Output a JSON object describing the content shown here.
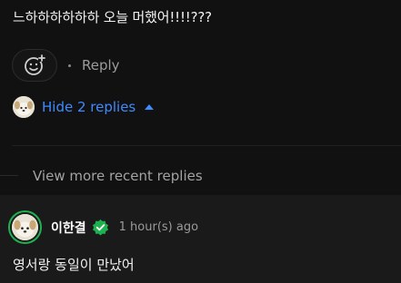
{
  "comment": {
    "text": "느하하하하하하 오늘 머했어!!!!???",
    "reply_label": "Reply",
    "replies_toggle_label": "Hide 2 replies"
  },
  "thread": {
    "view_more_label": "View more recent replies"
  },
  "reply": {
    "username": "이한결",
    "timestamp": "1 hour(s) ago",
    "text": "영서랑 동일이 만났어"
  },
  "colors": {
    "background": "#111111",
    "reply_background": "#1a1a1a",
    "link_blue": "#3d8bff",
    "verified_green": "#1fb14f"
  },
  "icons": {
    "emoji_button": "add-emoji-icon",
    "toggle": "caret-up-icon",
    "verified": "verified-check-icon"
  }
}
